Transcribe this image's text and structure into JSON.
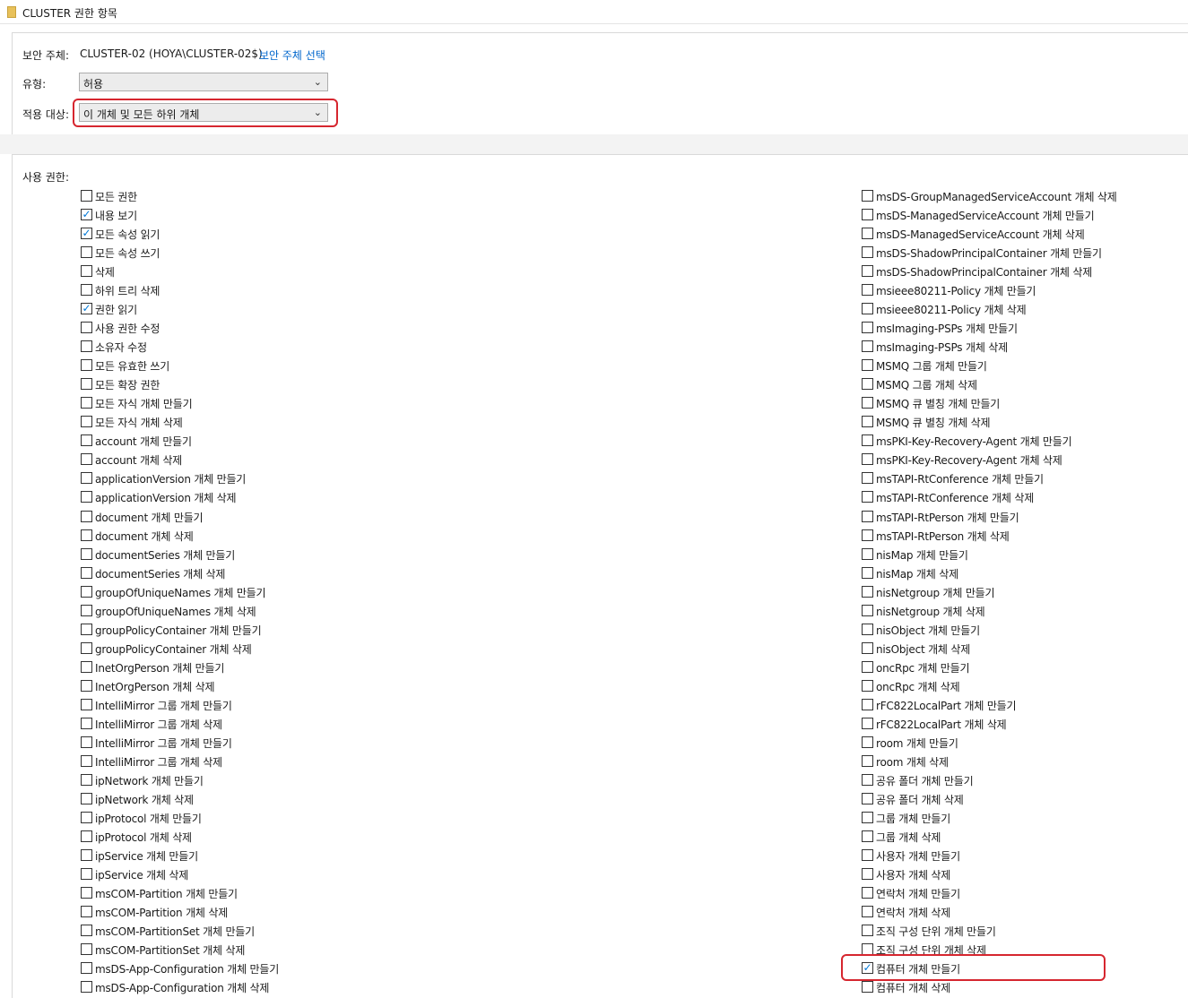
{
  "window": {
    "title": "CLUSTER 권한 항목"
  },
  "principal": {
    "label": "보안 주체:",
    "value": "CLUSTER-02 (HOYA\\CLUSTER-02$)",
    "select_link": "보안 주체 선택"
  },
  "type_field": {
    "label": "유형:",
    "value": "허용"
  },
  "applies_to": {
    "label": "적용 대상:",
    "value": "이 개체 및 모든 하위 개체"
  },
  "permissions": {
    "label": "사용 권한:",
    "left": [
      {
        "label": "모든 권한",
        "checked": false
      },
      {
        "label": "내용 보기",
        "checked": true
      },
      {
        "label": "모든 속성 읽기",
        "checked": true
      },
      {
        "label": "모든 속성 쓰기",
        "checked": false
      },
      {
        "label": "삭제",
        "checked": false
      },
      {
        "label": "하위 트리 삭제",
        "checked": false
      },
      {
        "label": "권한 읽기",
        "checked": true
      },
      {
        "label": "사용 권한 수정",
        "checked": false
      },
      {
        "label": "소유자 수정",
        "checked": false
      },
      {
        "label": "모든 유효한 쓰기",
        "checked": false
      },
      {
        "label": "모든 확장 권한",
        "checked": false
      },
      {
        "label": "모든 자식 개체 만들기",
        "checked": false
      },
      {
        "label": "모든 자식 개체 삭제",
        "checked": false
      },
      {
        "label": "account 개체 만들기",
        "checked": false
      },
      {
        "label": "account 개체 삭제",
        "checked": false
      },
      {
        "label": "applicationVersion 개체 만들기",
        "checked": false
      },
      {
        "label": "applicationVersion 개체 삭제",
        "checked": false
      },
      {
        "label": "document 개체 만들기",
        "checked": false
      },
      {
        "label": "document 개체 삭제",
        "checked": false
      },
      {
        "label": "documentSeries 개체 만들기",
        "checked": false
      },
      {
        "label": "documentSeries 개체 삭제",
        "checked": false
      },
      {
        "label": "groupOfUniqueNames 개체 만들기",
        "checked": false
      },
      {
        "label": "groupOfUniqueNames 개체 삭제",
        "checked": false
      },
      {
        "label": "groupPolicyContainer 개체 만들기",
        "checked": false
      },
      {
        "label": "groupPolicyContainer 개체 삭제",
        "checked": false
      },
      {
        "label": "InetOrgPerson 개체 만들기",
        "checked": false
      },
      {
        "label": "InetOrgPerson 개체 삭제",
        "checked": false
      },
      {
        "label": "IntelliMirror 그룹 개체 만들기",
        "checked": false
      },
      {
        "label": "IntelliMirror 그룹 개체 삭제",
        "checked": false
      },
      {
        "label": "IntelliMirror 그룹 개체 만들기",
        "checked": false
      },
      {
        "label": "IntelliMirror 그룹 개체 삭제",
        "checked": false
      },
      {
        "label": "ipNetwork 개체 만들기",
        "checked": false
      },
      {
        "label": "ipNetwork 개체 삭제",
        "checked": false
      },
      {
        "label": "ipProtocol 개체 만들기",
        "checked": false
      },
      {
        "label": "ipProtocol 개체 삭제",
        "checked": false
      },
      {
        "label": "ipService 개체 만들기",
        "checked": false
      },
      {
        "label": "ipService 개체 삭제",
        "checked": false
      },
      {
        "label": "msCOM-Partition 개체 만들기",
        "checked": false
      },
      {
        "label": "msCOM-Partition 개체 삭제",
        "checked": false
      },
      {
        "label": "msCOM-PartitionSet 개체 만들기",
        "checked": false
      },
      {
        "label": "msCOM-PartitionSet 개체 삭제",
        "checked": false
      },
      {
        "label": "msDS-App-Configuration 개체 만들기",
        "checked": false
      },
      {
        "label": "msDS-App-Configuration 개체 삭제",
        "checked": false
      }
    ],
    "right": [
      {
        "label": "msDS-GroupManagedServiceAccount 개체 삭제",
        "checked": false
      },
      {
        "label": "msDS-ManagedServiceAccount 개체 만들기",
        "checked": false
      },
      {
        "label": "msDS-ManagedServiceAccount 개체 삭제",
        "checked": false
      },
      {
        "label": "msDS-ShadowPrincipalContainer 개체 만들기",
        "checked": false
      },
      {
        "label": "msDS-ShadowPrincipalContainer 개체 삭제",
        "checked": false
      },
      {
        "label": "msieee80211-Policy 개체 만들기",
        "checked": false
      },
      {
        "label": "msieee80211-Policy 개체 삭제",
        "checked": false
      },
      {
        "label": "msImaging-PSPs 개체 만들기",
        "checked": false
      },
      {
        "label": "msImaging-PSPs 개체 삭제",
        "checked": false
      },
      {
        "label": "MSMQ 그룹 개체 만들기",
        "checked": false
      },
      {
        "label": "MSMQ 그룹 개체 삭제",
        "checked": false
      },
      {
        "label": "MSMQ 큐 별칭 개체 만들기",
        "checked": false
      },
      {
        "label": "MSMQ 큐 별칭 개체 삭제",
        "checked": false
      },
      {
        "label": "msPKI-Key-Recovery-Agent 개체 만들기",
        "checked": false
      },
      {
        "label": "msPKI-Key-Recovery-Agent 개체 삭제",
        "checked": false
      },
      {
        "label": "msTAPI-RtConference 개체 만들기",
        "checked": false
      },
      {
        "label": "msTAPI-RtConference 개체 삭제",
        "checked": false
      },
      {
        "label": "msTAPI-RtPerson 개체 만들기",
        "checked": false
      },
      {
        "label": "msTAPI-RtPerson 개체 삭제",
        "checked": false
      },
      {
        "label": "nisMap 개체 만들기",
        "checked": false
      },
      {
        "label": "nisMap 개체 삭제",
        "checked": false
      },
      {
        "label": "nisNetgroup 개체 만들기",
        "checked": false
      },
      {
        "label": "nisNetgroup 개체 삭제",
        "checked": false
      },
      {
        "label": "nisObject 개체 만들기",
        "checked": false
      },
      {
        "label": "nisObject 개체 삭제",
        "checked": false
      },
      {
        "label": "oncRpc 개체 만들기",
        "checked": false
      },
      {
        "label": "oncRpc 개체 삭제",
        "checked": false
      },
      {
        "label": "rFC822LocalPart 개체 만들기",
        "checked": false
      },
      {
        "label": "rFC822LocalPart 개체 삭제",
        "checked": false
      },
      {
        "label": "room 개체 만들기",
        "checked": false
      },
      {
        "label": "room 개체 삭제",
        "checked": false
      },
      {
        "label": "공유 폴더 개체 만들기",
        "checked": false
      },
      {
        "label": "공유 폴더 개체 삭제",
        "checked": false
      },
      {
        "label": "그룹 개체 만들기",
        "checked": false
      },
      {
        "label": "그룹 개체 삭제",
        "checked": false
      },
      {
        "label": "사용자 개체 만들기",
        "checked": false
      },
      {
        "label": "사용자 개체 삭제",
        "checked": false
      },
      {
        "label": "연락처 개체 만들기",
        "checked": false
      },
      {
        "label": "연락처 개체 삭제",
        "checked": false
      },
      {
        "label": "조직 구성 단위 개체 만들기",
        "checked": false
      },
      {
        "label": "조직 구성 단위 개체 삭제",
        "checked": false
      },
      {
        "label": "컴퓨터 개체 만들기",
        "checked": true
      },
      {
        "label": "컴퓨터 개체 삭제",
        "checked": false
      }
    ]
  }
}
